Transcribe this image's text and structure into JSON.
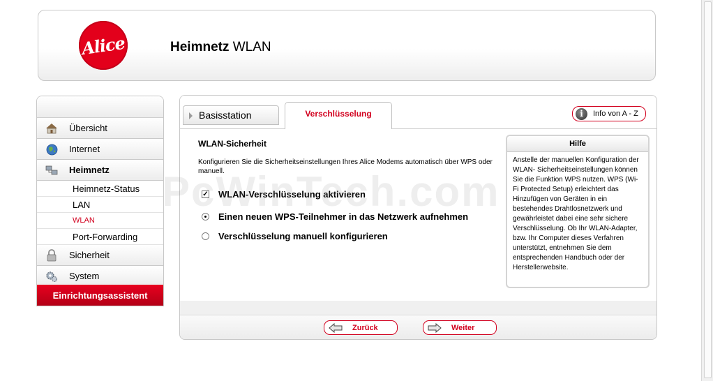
{
  "header": {
    "logo_text": "Alice",
    "title_bold": "Heimnetz",
    "title_rest": " WLAN"
  },
  "sidebar": {
    "items": [
      {
        "label": "Übersicht",
        "icon": "house-icon"
      },
      {
        "label": "Internet",
        "icon": "globe-icon"
      },
      {
        "label": "Heimnetz",
        "icon": "network-icon"
      },
      {
        "label": "Sicherheit",
        "icon": "lock-icon"
      },
      {
        "label": "System",
        "icon": "gears-icon"
      }
    ],
    "subitems": [
      "Heimnetz-Status",
      "LAN",
      "WLAN",
      "Port-Forwarding"
    ],
    "wizard_label": "Einrichtungsassistent"
  },
  "tabs": {
    "basisstation": "Basisstation",
    "verschluesselung": "Verschlüsselung"
  },
  "info_button": "Info von A - Z",
  "section": {
    "title": "WLAN-Sicherheit",
    "description": "Konfigurieren Sie die Sicherheitseinstellungen Ihres Alice Modems automatisch über WPS oder manuell.",
    "checkbox_label": "WLAN-Verschlüsselung aktivieren",
    "checkbox_checked": true,
    "radio_1": "Einen neuen WPS-Teilnehmer in das Netzwerk aufnehmen",
    "radio_2": "Verschlüsselung manuell konfigurieren",
    "selected_radio": 1
  },
  "help": {
    "title": "Hilfe",
    "text": "Anstelle der manuellen Konfiguration der WLAN- Sicherheitseinstellungen können Sie die Funktion WPS nutzen. WPS (Wi-Fi Protected Setup) erleichtert das Hinzufügen von Geräten in ein bestehendes Drahtlosnetzwerk und gewährleistet dabei eine sehr sichere Verschlüsselung. Ob Ihr WLAN-Adapter, bzw. Ihr Computer dieses Verfahren unterstützt, entnehmen Sie dem entsprechenden Handbuch oder der Herstellerwebsite."
  },
  "buttons": {
    "back": "Zurück",
    "next": "Weiter"
  },
  "watermark": "PcWinTech.com",
  "colors": {
    "accent_red": "#d2001e",
    "logo_red": "#e3001b"
  }
}
